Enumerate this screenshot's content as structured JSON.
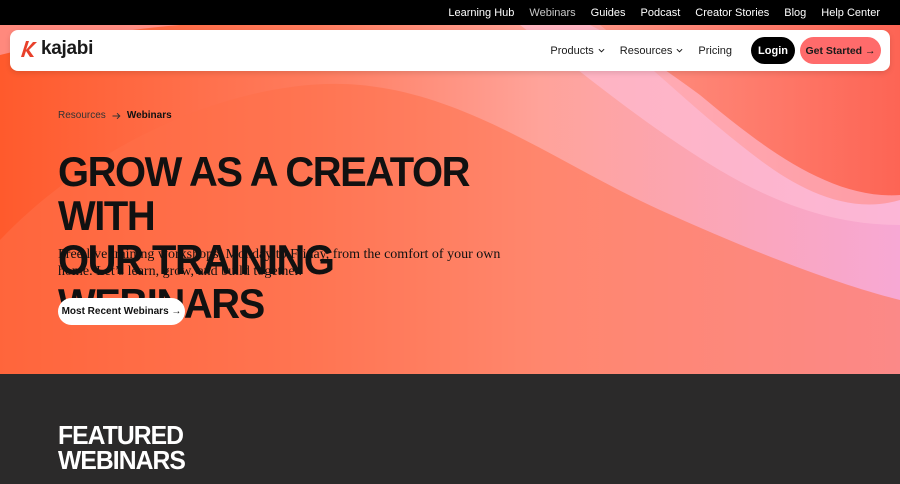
{
  "topbar": {
    "links": [
      "Learning Hub",
      "Webinars",
      "Guides",
      "Podcast",
      "Creator Stories",
      "Blog",
      "Help Center"
    ],
    "active": "Webinars"
  },
  "nav": {
    "brand": "kajabi",
    "products": "Products",
    "resources": "Resources",
    "pricing": "Pricing",
    "login": "Login",
    "get_started": "Get Started →"
  },
  "breadcrumb": {
    "root": "Resources",
    "current": "Webinars"
  },
  "hero": {
    "headline_line1": "GROW AS A CREATOR WITH",
    "headline_line2": "OUR TRAINING WEBINARS",
    "subtitle": "Free live training workshops, Monday to Friday, from the comfort of your own home. Let’s learn, grow, and build together.",
    "cta": "Most Recent Webinars →"
  },
  "featured": {
    "line1": "FEATURED",
    "line2": "WEBINARS"
  },
  "colors": {
    "accent": "#ff6b6b",
    "brand_red": "#e8402a",
    "dark": "#2b2a2a"
  }
}
